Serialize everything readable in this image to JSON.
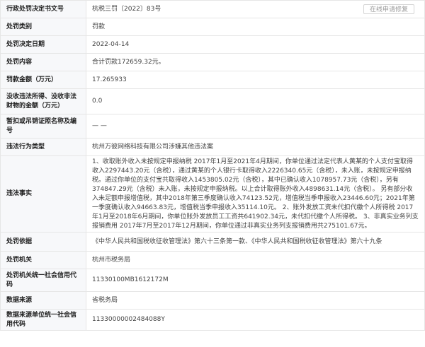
{
  "rows": {
    "decision_no": {
      "label": "行政处罚决定书文号",
      "value": "杭税三罚〔2022〕83号"
    },
    "category": {
      "label": "处罚类别",
      "value": "罚款"
    },
    "decision_date": {
      "label": "处罚决定日期",
      "value": "2022-04-14"
    },
    "content": {
      "label": "处罚内容",
      "value": "合计罚款172659.32元。"
    },
    "fine_amount": {
      "label": "罚款金额（万元）",
      "value": "17.265933"
    },
    "confiscated": {
      "label": "没收违法所得、没收非法财物的金额（万元）",
      "value": "0.0"
    },
    "license_revoked": {
      "label": "暂扣或吊销证照名称及编号",
      "value": "— —"
    },
    "violation_type": {
      "label": "违法行为类型",
      "value": "杭州万彼网络科技有限公司涉嫌其他违法案"
    },
    "facts": {
      "label": "违法事实",
      "value": "1、收取账外收入未按规定申报纳税 2017年1月至2021年4月期间，你单位通过法定代表人黄某的个人支付宝取得收入2297443.20元（含税），通过黄某的个人银行卡取得收入2226340.65元（含税），未入账，未按规定申报纳税。通过你单位的支付宝共取得收入1453805.02元（含税），其中已确认收入1078957.73元（含税），另有374847.29元（含税）未入账，未按规定申报纳税。以上合计取得账外收入4898631.14元（含税）。 另有部分收入未足额申报增值税，其中2018年第三季度确认收入74123.52元，增值税当季申报收入23446.60元；2021年第一季度确认收入94663.83元，增值税当季申报收入35114.10元。 2、账外发放工资未代扣代缴个人所得税 2017年1月至2018年6月期间，你单位账外发放员工工资共641902.34元，未代扣代缴个人所得税。 3、非真实业务列支报销费用 2017年7月至2017年12月期间，你单位通过非真实业务列支报销费用共275101.67元。"
    },
    "basis": {
      "label": "处罚依据",
      "value": "《中华人民共和国税收征收管理法》第六十三条第一款、《中华人民共和国税收征收管理法》第六十九条"
    },
    "authority": {
      "label": "处罚机关",
      "value": "杭州市税务局"
    },
    "authority_code": {
      "label": "处罚机关统一社会信用代码",
      "value": "11330100MB1612172M"
    },
    "source": {
      "label": "数据来源",
      "value": "省税务局"
    },
    "source_code": {
      "label": "数据来源单位统一社会信用代码",
      "value": "11330000002484088Y"
    }
  },
  "repair_button": "在线申请修复"
}
